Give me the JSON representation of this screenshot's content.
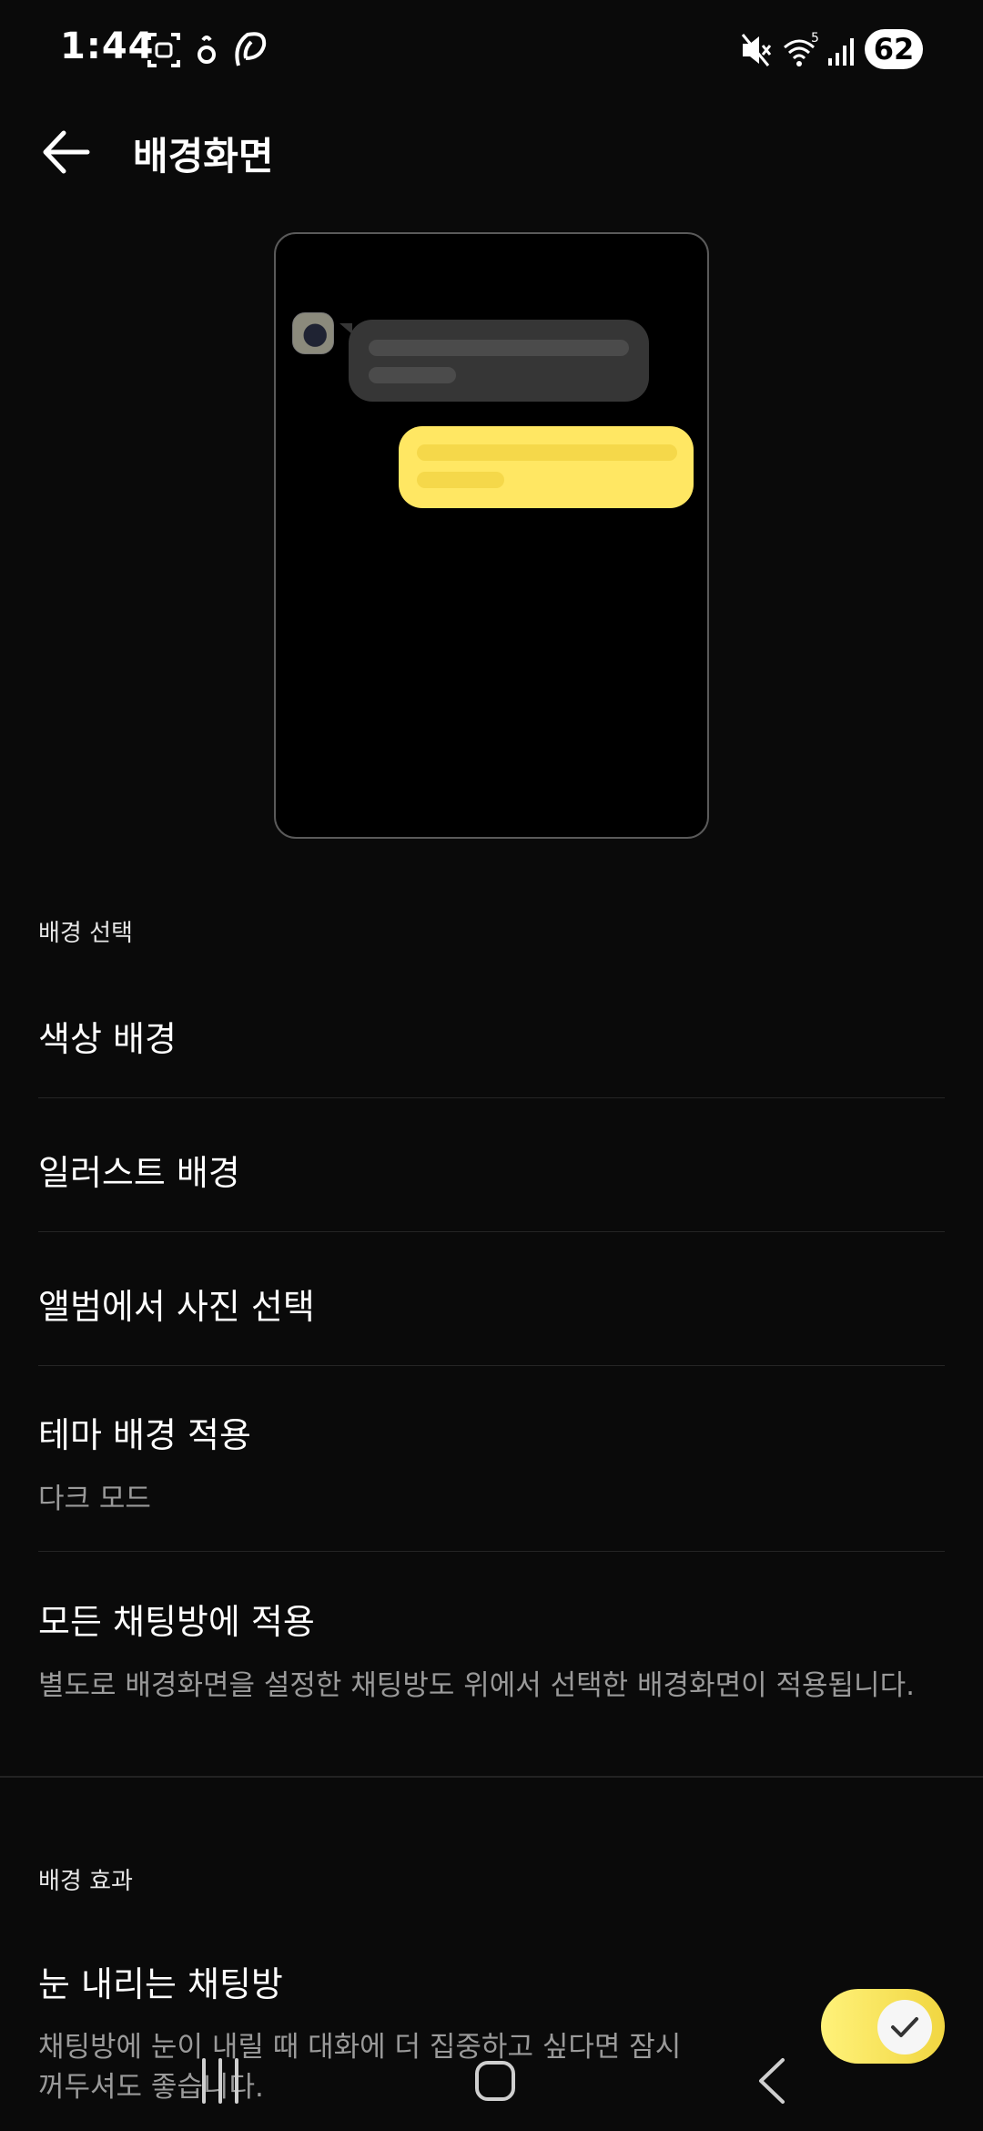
{
  "status_bar": {
    "time": "1:44",
    "battery": "62",
    "icons": [
      "face-scan-icon",
      "notification-icon",
      "leaf-icon",
      "mute-icon",
      "wifi-icon",
      "signal-icon"
    ]
  },
  "header": {
    "title": "배경화면",
    "back_icon": "arrow-left-icon"
  },
  "preview": {
    "bubble_left_color": "#363636",
    "bubble_right_color": "#ffe763"
  },
  "section_background_select": {
    "label": "배경 선택",
    "items": [
      {
        "title": "색상 배경"
      },
      {
        "title": "일러스트 배경"
      },
      {
        "title": "앨범에서 사진 선택"
      },
      {
        "title": "테마 배경 적용",
        "subtitle": "다크 모드"
      },
      {
        "title": "모든 채팅방에 적용",
        "subtitle": "별도로 배경화면을 설정한 채팅방도 위에서 선택한 배경화면이 적용됩니다."
      }
    ]
  },
  "section_background_effect": {
    "label": "배경 효과",
    "items": [
      {
        "title": "눈 내리는 채팅방",
        "subtitle_line1": "채팅방에 눈이 내릴 때 대화에 더 집중하고 싶다면 잠시",
        "subtitle_line2": "꺼두셔도 좋습니다.",
        "toggle_on": true
      }
    ]
  },
  "colors": {
    "accent": "#ffe763",
    "background": "#0a0a0a"
  },
  "nav_bar": {
    "icons": [
      "recent-apps-icon",
      "home-icon",
      "back-icon"
    ]
  }
}
